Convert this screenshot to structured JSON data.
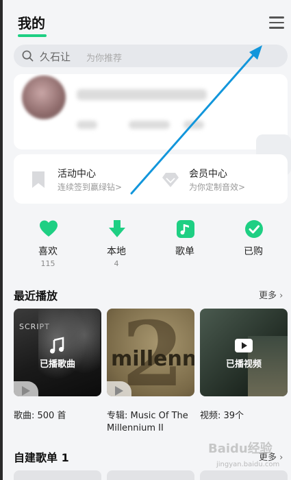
{
  "header": {
    "title": "我的"
  },
  "search": {
    "value": "久石让",
    "placeholder": "为你推荐"
  },
  "activity": [
    {
      "title": "活动中心",
      "subtitle": "连续签到赢绿钻>"
    },
    {
      "title": "会员中心",
      "subtitle": "为你定制音效>"
    }
  ],
  "quick": [
    {
      "label": "喜欢",
      "count": "115",
      "icon": "heart-icon"
    },
    {
      "label": "本地",
      "count": "4",
      "icon": "download-arrow-icon"
    },
    {
      "label": "歌单",
      "count": "",
      "icon": "music-note-icon"
    },
    {
      "label": "已购",
      "count": "",
      "icon": "check-circle-icon"
    }
  ],
  "recent": {
    "title": "最近播放",
    "more": "更多",
    "tiles": [
      {
        "overlay": "已播歌曲",
        "cover_text": "SCRIPT",
        "caption": "歌曲: 500 首"
      },
      {
        "overlay": "",
        "cover_text": "millenn",
        "caption": "专辑: Music Of The Millennium II"
      },
      {
        "overlay": "已播视频",
        "cover_text": "",
        "caption": "视频: 39个"
      }
    ]
  },
  "playlists": {
    "title": "自建歌单 1",
    "more": "更多"
  },
  "watermark": {
    "brand": "Baidu经验",
    "url": "jingyan.baidu.com"
  },
  "colors": {
    "accent": "#1ecf83",
    "annotation_arrow": "#1296db"
  }
}
